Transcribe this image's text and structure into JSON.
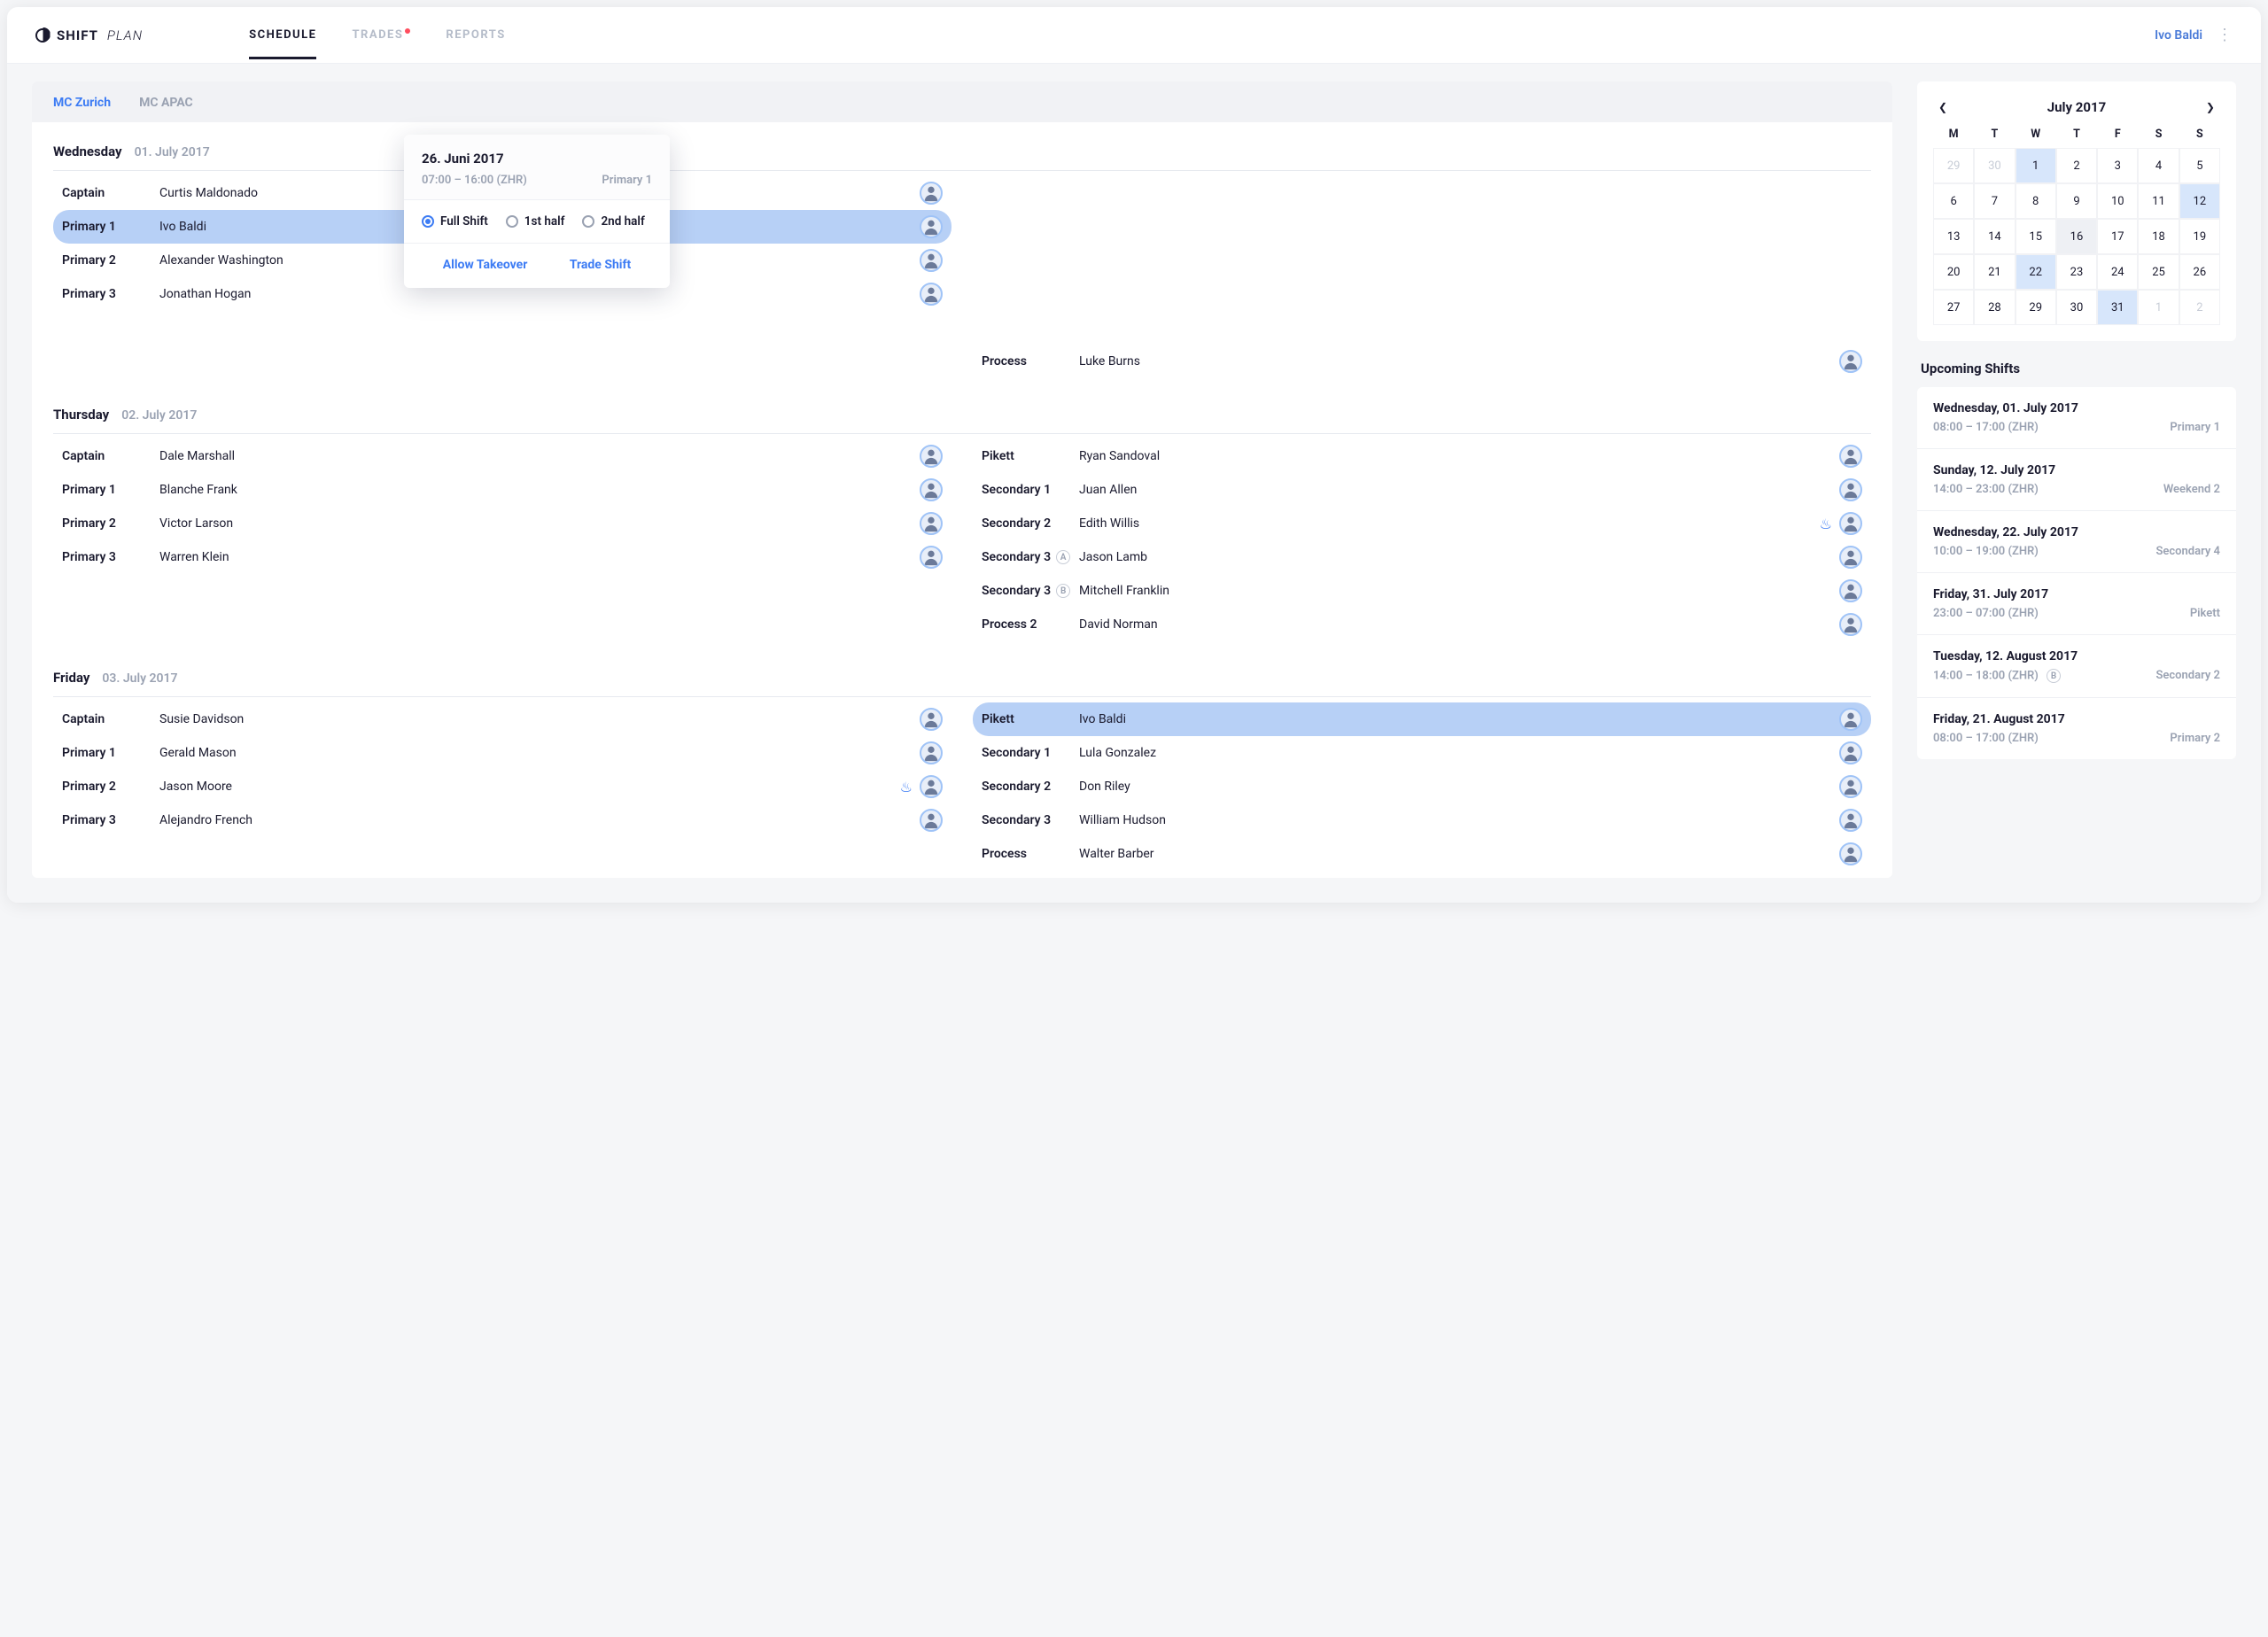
{
  "brand": {
    "name1": "SHIFT",
    "name2": "PLAN"
  },
  "nav": {
    "items": [
      {
        "label": "SCHEDULE",
        "active": true
      },
      {
        "label": "TRADES",
        "dot": true
      },
      {
        "label": "REPORTS"
      }
    ]
  },
  "user": {
    "name": "Ivo Baldi"
  },
  "tabs": [
    {
      "label": "MC Zurich",
      "active": true
    },
    {
      "label": "MC APAC"
    }
  ],
  "days": [
    {
      "name": "Wednesday",
      "date": "01. July 2017",
      "left": [
        {
          "role": "Captain",
          "person": "Curtis Maldonado"
        },
        {
          "role": "Primary 1",
          "person": "Ivo Baldi",
          "highlight": true
        },
        {
          "role": "Primary 2",
          "person": "Alexander Washington"
        },
        {
          "role": "Primary 3",
          "person": "Jonathan Hogan"
        }
      ],
      "right": [
        {
          "role": "",
          "person": ""
        },
        {
          "role": "",
          "person": ""
        },
        {
          "role": "",
          "person": ""
        },
        {
          "role": "",
          "person": ""
        },
        {
          "role": "",
          "person": ""
        },
        {
          "role": "Process",
          "person": "Luke Burns"
        }
      ]
    },
    {
      "name": "Thursday",
      "date": "02. July 2017",
      "left": [
        {
          "role": "Captain",
          "person": "Dale Marshall"
        },
        {
          "role": "Primary 1",
          "person": "Blanche Frank"
        },
        {
          "role": "Primary 2",
          "person": "Victor Larson"
        },
        {
          "role": "Primary 3",
          "person": "Warren Klein"
        }
      ],
      "right": [
        {
          "role": "Pikett",
          "person": "Ryan Sandoval"
        },
        {
          "role": "Secondary 1",
          "person": "Juan Allen"
        },
        {
          "role": "Secondary 2",
          "person": "Edith Willis",
          "fire": true
        },
        {
          "role": "Secondary 3",
          "person": "Jason Lamb",
          "badge": "A"
        },
        {
          "role": "Secondary 3",
          "person": "Mitchell Franklin",
          "badge": "B"
        },
        {
          "role": "Process 2",
          "person": "David Norman"
        }
      ]
    },
    {
      "name": "Friday",
      "date": "03. July 2017",
      "left": [
        {
          "role": "Captain",
          "person": "Susie Davidson"
        },
        {
          "role": "Primary 1",
          "person": "Gerald Mason"
        },
        {
          "role": "Primary 2",
          "person": "Jason Moore",
          "fire": true
        },
        {
          "role": "Primary 3",
          "person": "Alejandro French"
        }
      ],
      "right": [
        {
          "role": "Pikett",
          "person": "Ivo Baldi",
          "highlight": true
        },
        {
          "role": "Secondary 1",
          "person": "Lula Gonzalez"
        },
        {
          "role": "Secondary 2",
          "person": "Don Riley"
        },
        {
          "role": "Secondary 3",
          "person": "William Hudson"
        },
        {
          "role": "Process",
          "person": "Walter Barber"
        }
      ]
    }
  ],
  "popover": {
    "title": "26. Juni 2017",
    "time": "07:00 – 16:00 (ZHR)",
    "role": "Primary 1",
    "options": {
      "full": "Full Shift",
      "first": "1st half",
      "second": "2nd half"
    },
    "actions": {
      "takeover": "Allow Takeover",
      "trade": "Trade Shift"
    }
  },
  "calendar": {
    "title": "July 2017",
    "dow": [
      "M",
      "T",
      "W",
      "T",
      "F",
      "S",
      "S"
    ],
    "cells": [
      {
        "n": "29",
        "muted": true
      },
      {
        "n": "30",
        "muted": true
      },
      {
        "n": "1",
        "hl": true
      },
      {
        "n": "2"
      },
      {
        "n": "3"
      },
      {
        "n": "4"
      },
      {
        "n": "5"
      },
      {
        "n": "6"
      },
      {
        "n": "7"
      },
      {
        "n": "8"
      },
      {
        "n": "9"
      },
      {
        "n": "10"
      },
      {
        "n": "11"
      },
      {
        "n": "12",
        "hl": true
      },
      {
        "n": "13"
      },
      {
        "n": "14"
      },
      {
        "n": "15"
      },
      {
        "n": "16",
        "box": true
      },
      {
        "n": "17"
      },
      {
        "n": "18"
      },
      {
        "n": "19"
      },
      {
        "n": "20"
      },
      {
        "n": "21"
      },
      {
        "n": "22",
        "hl": true
      },
      {
        "n": "23"
      },
      {
        "n": "24"
      },
      {
        "n": "25"
      },
      {
        "n": "26"
      },
      {
        "n": "27"
      },
      {
        "n": "28"
      },
      {
        "n": "29"
      },
      {
        "n": "30"
      },
      {
        "n": "31",
        "hl": true
      },
      {
        "n": "1",
        "muted": true
      },
      {
        "n": "2",
        "muted": true
      }
    ]
  },
  "upcoming": {
    "title": "Upcoming Shifts",
    "items": [
      {
        "date": "Wednesday, 01. July 2017",
        "time": "08:00 – 17:00 (ZHR)",
        "role": "Primary 1"
      },
      {
        "date": "Sunday, 12. July 2017",
        "time": "14:00 – 23:00 (ZHR)",
        "role": "Weekend 2"
      },
      {
        "date": "Wednesday, 22. July 2017",
        "time": "10:00 – 19:00 (ZHR)",
        "role": "Secondary 4"
      },
      {
        "date": "Friday, 31. July 2017",
        "time": "23:00 – 07:00 (ZHR)",
        "role": "Pikett"
      },
      {
        "date": "Tuesday, 12. August 2017",
        "time": "14:00 – 18:00 (ZHR)",
        "role": "Secondary 2",
        "badge": "B"
      },
      {
        "date": "Friday, 21. August 2017",
        "time": "08:00 – 17:00 (ZHR)",
        "role": "Primary 2"
      }
    ]
  }
}
